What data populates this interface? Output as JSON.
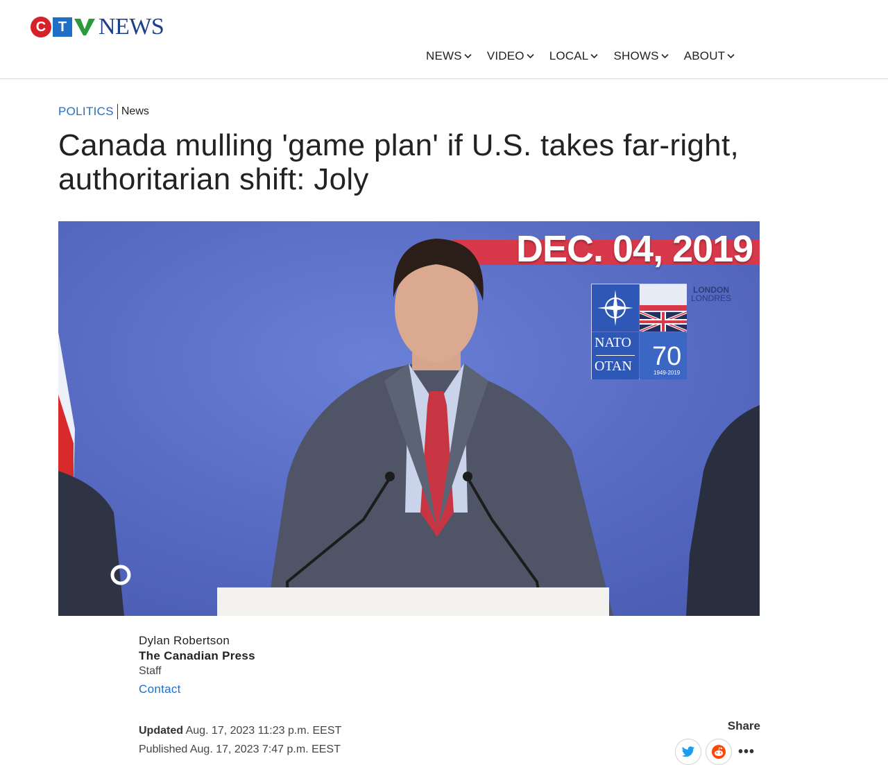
{
  "brand": {
    "logo_letters": [
      "C",
      "T",
      "V"
    ],
    "logo_word": "NEWS",
    "colors": {
      "red": "#d6202a",
      "blue": "#1f6fc7",
      "green": "#2a9a3c",
      "navy": "#1d3f8a"
    }
  },
  "nav": {
    "items": [
      {
        "label": "NEWS",
        "icon": "chevron-down-icon"
      },
      {
        "label": "VIDEO",
        "icon": "chevron-down-icon"
      },
      {
        "label": "LOCAL",
        "icon": "chevron-down-icon"
      },
      {
        "label": "SHOWS",
        "icon": "chevron-down-icon"
      },
      {
        "label": "ABOUT",
        "icon": "chevron-down-icon"
      }
    ]
  },
  "article": {
    "section": "POLITICS",
    "type": "News",
    "headline": "Canada mulling 'game plan' if U.S. takes far-right, authoritarian shift: Joly",
    "hero": {
      "date_banner": "DEC. 04, 2019",
      "badge": {
        "london": "LONDON",
        "londres": "LONDRES",
        "nato": "NATO",
        "otan": "OTAN",
        "anniversary": "70",
        "years": "1949-2019"
      }
    },
    "byline": {
      "name": "Dylan Robertson",
      "organization": "The Canadian Press",
      "role": "Staff",
      "contact": "Contact"
    },
    "timestamps": {
      "updated_label": "Updated",
      "updated": "Aug. 17, 2023 11:23 p.m. EEST",
      "published_label": "Published",
      "published": "Aug. 17, 2023 7:47 p.m. EEST"
    },
    "share": {
      "label": "Share",
      "buttons": [
        "twitter-icon",
        "reddit-icon"
      ],
      "more": "•••"
    }
  }
}
